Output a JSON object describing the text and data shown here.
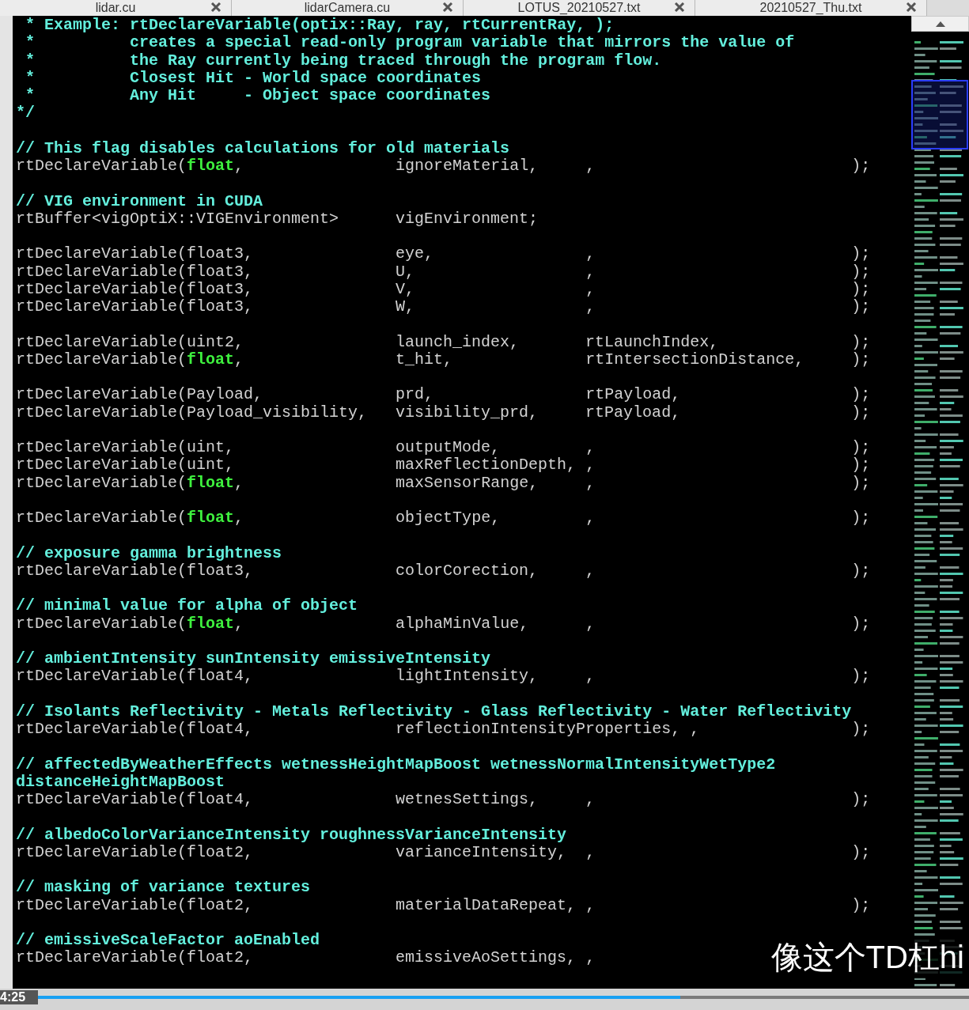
{
  "tabs": [
    {
      "label": "lidar.cu"
    },
    {
      "label": "lidarCamera.cu"
    },
    {
      "label": "LOTUS_20210527.txt"
    },
    {
      "label": "20210527_Thu.txt"
    }
  ],
  "lines": [
    {
      "kind": "comment",
      "text": " * Example: rtDeclareVariable(optix::Ray, ray, rtCurrentRay, );"
    },
    {
      "kind": "comment",
      "text": " *          creates a special read-only program variable that mirrors the value of"
    },
    {
      "kind": "comment",
      "text": " *          the Ray currently being traced through the program flow."
    },
    {
      "kind": "comment",
      "text": " *          Closest Hit - World space coordinates"
    },
    {
      "kind": "comment",
      "text": " *          Any Hit     - Object space coordinates"
    },
    {
      "kind": "comment",
      "text": "*/"
    },
    {
      "kind": "blank"
    },
    {
      "kind": "comment",
      "text": "// This flag disables calculations for old materials"
    },
    {
      "kind": "code",
      "type": "rtDeclareVariable(**float**,",
      "name": "ignoreMaterial,",
      "semantic": ",",
      "end": ");"
    },
    {
      "kind": "blank"
    },
    {
      "kind": "comment",
      "text": "// VIG environment in CUDA"
    },
    {
      "kind": "code",
      "type": "rtBuffer<vigOptiX::VIGEnvironment>",
      "name": "vigEnvironment;"
    },
    {
      "kind": "blank"
    },
    {
      "kind": "code",
      "type": "rtDeclareVariable(float3,",
      "name": "eye,",
      "semantic": ",",
      "end": ");"
    },
    {
      "kind": "code",
      "type": "rtDeclareVariable(float3,",
      "name": "U,",
      "semantic": ",",
      "end": ");"
    },
    {
      "kind": "code",
      "type": "rtDeclareVariable(float3,",
      "name": "V,",
      "semantic": ",",
      "end": ");"
    },
    {
      "kind": "code",
      "type": "rtDeclareVariable(float3,",
      "name": "W,",
      "semantic": ",",
      "end": ");"
    },
    {
      "kind": "blank"
    },
    {
      "kind": "code",
      "type": "rtDeclareVariable(uint2,",
      "name": "launch_index,",
      "semantic": "rtLaunchIndex,",
      "end": ");"
    },
    {
      "kind": "code",
      "type": "rtDeclareVariable(**float**,",
      "name": "t_hit,",
      "semantic": "rtIntersectionDistance,",
      "end": ");"
    },
    {
      "kind": "blank"
    },
    {
      "kind": "code",
      "type": "rtDeclareVariable(Payload,",
      "name": "prd,",
      "semantic": "rtPayload,",
      "end": ");"
    },
    {
      "kind": "code",
      "type": "rtDeclareVariable(Payload_visibility,",
      "name": "visibility_prd,",
      "semantic": "rtPayload,",
      "end": ");"
    },
    {
      "kind": "blank"
    },
    {
      "kind": "code",
      "type": "rtDeclareVariable(uint,",
      "name": "outputMode,",
      "semantic": ",",
      "end": ");"
    },
    {
      "kind": "code",
      "type": "rtDeclareVariable(uint,",
      "name": "maxReflectionDepth,",
      "semantic": ",",
      "end": ");"
    },
    {
      "kind": "code",
      "type": "rtDeclareVariable(**float**,",
      "name": "maxSensorRange,",
      "semantic": ",",
      "end": ");"
    },
    {
      "kind": "blank"
    },
    {
      "kind": "code",
      "type": "rtDeclareVariable(**float**,",
      "name": "objectType,",
      "semantic": ",",
      "end": ");"
    },
    {
      "kind": "blank"
    },
    {
      "kind": "comment",
      "text": "// exposure gamma brightness"
    },
    {
      "kind": "code",
      "type": "rtDeclareVariable(float3,",
      "name": "colorCorection,",
      "semantic": ",",
      "end": ");"
    },
    {
      "kind": "blank"
    },
    {
      "kind": "comment",
      "text": "// minimal value for alpha of object"
    },
    {
      "kind": "code",
      "type": "rtDeclareVariable(**float**,",
      "name": "alphaMinValue,",
      "semantic": ",",
      "end": ");"
    },
    {
      "kind": "blank"
    },
    {
      "kind": "comment",
      "text": "// ambientIntensity sunIntensity emissiveIntensity"
    },
    {
      "kind": "code",
      "type": "rtDeclareVariable(float4,",
      "name": "lightIntensity,",
      "semantic": ",",
      "end": ");"
    },
    {
      "kind": "blank"
    },
    {
      "kind": "comment",
      "text": "// Isolants Reflectivity - Metals Reflectivity - Glass Reflectivity - Water Reflectivity"
    },
    {
      "kind": "code",
      "type": "rtDeclareVariable(float4,",
      "name": "reflectionIntensityProperties,",
      "semantic": ",",
      "end": ");"
    },
    {
      "kind": "blank"
    },
    {
      "kind": "comment",
      "text": "// affectedByWeatherEffects wetnessHeightMapBoost wetnessNormalIntensityWetType2 distanceHeightMapBoost"
    },
    {
      "kind": "code",
      "type": "rtDeclareVariable(float4,",
      "name": "wetnesSettings,",
      "semantic": ",",
      "end": ");"
    },
    {
      "kind": "blank"
    },
    {
      "kind": "comment",
      "text": "// albedoColorVarianceIntensity roughnessVarianceIntensity"
    },
    {
      "kind": "code",
      "type": "rtDeclareVariable(float2,",
      "name": "varianceIntensity,",
      "semantic": ",",
      "end": ");"
    },
    {
      "kind": "blank"
    },
    {
      "kind": "comment",
      "text": "// masking of variance textures"
    },
    {
      "kind": "code",
      "type": "rtDeclareVariable(float2,",
      "name": "materialDataRepeat,",
      "semantic": ",",
      "end": ");"
    },
    {
      "kind": "blank"
    },
    {
      "kind": "comment",
      "text": "// emissiveScaleFactor aoEnabled"
    },
    {
      "kind": "code",
      "type": "rtDeclareVariable(float2,",
      "name": "emissiveAoSettings,",
      "semantic": ","
    }
  ],
  "player": {
    "time": "4:25",
    "level": 0.69,
    "subtitle": "像这个TD杠hi"
  }
}
